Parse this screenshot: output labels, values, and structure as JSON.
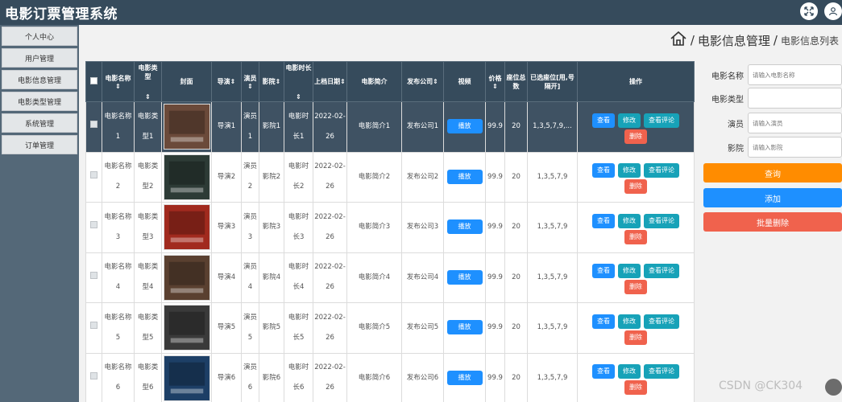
{
  "app": {
    "title": "电影订票管理系统"
  },
  "topbar": {
    "fullscreen_icon": "fullscreen-icon",
    "user_icon": "user-icon"
  },
  "sidebar": {
    "items": [
      {
        "label": "个人中心"
      },
      {
        "label": "用户管理"
      },
      {
        "label": "电影信息管理"
      },
      {
        "label": "电影类型管理"
      },
      {
        "label": "系统管理"
      },
      {
        "label": "订单管理"
      }
    ]
  },
  "breadcrumb": {
    "home_icon": "home-icon",
    "main": "电影信息管理",
    "sub": "电影信息列表"
  },
  "table": {
    "headers": {
      "name": "电影名称",
      "type": "电影类型",
      "cover": "封面",
      "director": "导演",
      "actor": "演员",
      "cinema": "影院",
      "duration": "电影时长",
      "release_date": "上档日期",
      "intro": "电影简介",
      "publisher": "发布公司",
      "video": "视频",
      "price": "价格",
      "seat_total": "座位总数",
      "selected_seats": "已选座位[用,号隔开]",
      "ops": "操作"
    },
    "buttons": {
      "play": "播放",
      "view": "查看",
      "edit": "修改",
      "review": "查看评论",
      "delete": "删除"
    },
    "rows": [
      {
        "name": "电影名称1",
        "type": "电影类型1",
        "director": "导演1",
        "actor": "演员1",
        "cinema": "影院1",
        "duration": "电影时长1",
        "date": "2022-02-26",
        "intro": "电影简介1",
        "publisher": "发布公司1",
        "price": "99.9",
        "seats": "20",
        "selected": "1,3,5,7,9,...",
        "poster_color": "#6b4a3a"
      },
      {
        "name": "电影名称2",
        "type": "电影类型2",
        "director": "导演2",
        "actor": "演员2",
        "cinema": "影院2",
        "duration": "电影时长2",
        "date": "2022-02-26",
        "intro": "电影简介2",
        "publisher": "发布公司2",
        "price": "99.9",
        "seats": "20",
        "selected": "1,3,5,7,9",
        "poster_color": "#2d3b36"
      },
      {
        "name": "电影名称3",
        "type": "电影类型3",
        "director": "导演3",
        "actor": "演员3",
        "cinema": "影院3",
        "duration": "电影时长3",
        "date": "2022-02-26",
        "intro": "电影简介3",
        "publisher": "发布公司3",
        "price": "99.9",
        "seats": "20",
        "selected": "1,3,5,7,9",
        "poster_color": "#a12a1e"
      },
      {
        "name": "电影名称4",
        "type": "电影类型4",
        "director": "导演4",
        "actor": "演员4",
        "cinema": "影院4",
        "duration": "电影时长4",
        "date": "2022-02-26",
        "intro": "电影简介4",
        "publisher": "发布公司4",
        "price": "99.9",
        "seats": "20",
        "selected": "1,3,5,7,9",
        "poster_color": "#5a4030"
      },
      {
        "name": "电影名称5",
        "type": "电影类型5",
        "director": "导演5",
        "actor": "演员5",
        "cinema": "影院5",
        "duration": "电影时长5",
        "date": "2022-02-26",
        "intro": "电影简介5",
        "publisher": "发布公司5",
        "price": "99.9",
        "seats": "20",
        "selected": "1,3,5,7,9",
        "poster_color": "#3a3a3a"
      },
      {
        "name": "电影名称6",
        "type": "电影类型6",
        "director": "导演6",
        "actor": "演员6",
        "cinema": "影院6",
        "duration": "电影时长6",
        "date": "2022-02-26",
        "intro": "电影简介6",
        "publisher": "发布公司6",
        "price": "99.9",
        "seats": "20",
        "selected": "1,3,5,7,9",
        "poster_color": "#1d3f66"
      }
    ]
  },
  "search": {
    "name_label": "电影名称",
    "name_placeholder": "请输入电影名称",
    "type_label": "电影类型",
    "type_placeholder": "",
    "actor_label": "演员",
    "actor_placeholder": "请输入演员",
    "cinema_label": "影院",
    "cinema_placeholder": "请输入影院",
    "query_label": "查询",
    "add_label": "添加",
    "batch_delete_label": "批量删除"
  },
  "colors": {
    "topbar": "#364b5c",
    "sidebar": "#546878",
    "query": "#ff8c00",
    "add": "#1e90ff",
    "batch_delete": "#f0624d"
  },
  "watermark": "CSDN @CK304"
}
